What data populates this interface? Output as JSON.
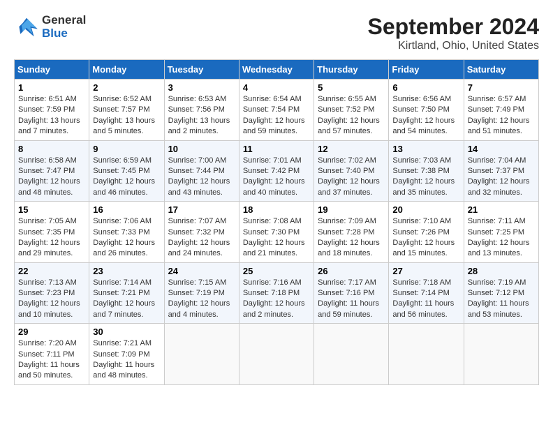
{
  "logo": {
    "line1": "General",
    "line2": "Blue"
  },
  "title": "September 2024",
  "subtitle": "Kirtland, Ohio, United States",
  "days_of_week": [
    "Sunday",
    "Monday",
    "Tuesday",
    "Wednesday",
    "Thursday",
    "Friday",
    "Saturday"
  ],
  "weeks": [
    [
      {
        "day": "1",
        "info": "Sunrise: 6:51 AM\nSunset: 7:59 PM\nDaylight: 13 hours and 7 minutes."
      },
      {
        "day": "2",
        "info": "Sunrise: 6:52 AM\nSunset: 7:57 PM\nDaylight: 13 hours and 5 minutes."
      },
      {
        "day": "3",
        "info": "Sunrise: 6:53 AM\nSunset: 7:56 PM\nDaylight: 13 hours and 2 minutes."
      },
      {
        "day": "4",
        "info": "Sunrise: 6:54 AM\nSunset: 7:54 PM\nDaylight: 12 hours and 59 minutes."
      },
      {
        "day": "5",
        "info": "Sunrise: 6:55 AM\nSunset: 7:52 PM\nDaylight: 12 hours and 57 minutes."
      },
      {
        "day": "6",
        "info": "Sunrise: 6:56 AM\nSunset: 7:50 PM\nDaylight: 12 hours and 54 minutes."
      },
      {
        "day": "7",
        "info": "Sunrise: 6:57 AM\nSunset: 7:49 PM\nDaylight: 12 hours and 51 minutes."
      }
    ],
    [
      {
        "day": "8",
        "info": "Sunrise: 6:58 AM\nSunset: 7:47 PM\nDaylight: 12 hours and 48 minutes."
      },
      {
        "day": "9",
        "info": "Sunrise: 6:59 AM\nSunset: 7:45 PM\nDaylight: 12 hours and 46 minutes."
      },
      {
        "day": "10",
        "info": "Sunrise: 7:00 AM\nSunset: 7:44 PM\nDaylight: 12 hours and 43 minutes."
      },
      {
        "day": "11",
        "info": "Sunrise: 7:01 AM\nSunset: 7:42 PM\nDaylight: 12 hours and 40 minutes."
      },
      {
        "day": "12",
        "info": "Sunrise: 7:02 AM\nSunset: 7:40 PM\nDaylight: 12 hours and 37 minutes."
      },
      {
        "day": "13",
        "info": "Sunrise: 7:03 AM\nSunset: 7:38 PM\nDaylight: 12 hours and 35 minutes."
      },
      {
        "day": "14",
        "info": "Sunrise: 7:04 AM\nSunset: 7:37 PM\nDaylight: 12 hours and 32 minutes."
      }
    ],
    [
      {
        "day": "15",
        "info": "Sunrise: 7:05 AM\nSunset: 7:35 PM\nDaylight: 12 hours and 29 minutes."
      },
      {
        "day": "16",
        "info": "Sunrise: 7:06 AM\nSunset: 7:33 PM\nDaylight: 12 hours and 26 minutes."
      },
      {
        "day": "17",
        "info": "Sunrise: 7:07 AM\nSunset: 7:32 PM\nDaylight: 12 hours and 24 minutes."
      },
      {
        "day": "18",
        "info": "Sunrise: 7:08 AM\nSunset: 7:30 PM\nDaylight: 12 hours and 21 minutes."
      },
      {
        "day": "19",
        "info": "Sunrise: 7:09 AM\nSunset: 7:28 PM\nDaylight: 12 hours and 18 minutes."
      },
      {
        "day": "20",
        "info": "Sunrise: 7:10 AM\nSunset: 7:26 PM\nDaylight: 12 hours and 15 minutes."
      },
      {
        "day": "21",
        "info": "Sunrise: 7:11 AM\nSunset: 7:25 PM\nDaylight: 12 hours and 13 minutes."
      }
    ],
    [
      {
        "day": "22",
        "info": "Sunrise: 7:13 AM\nSunset: 7:23 PM\nDaylight: 12 hours and 10 minutes."
      },
      {
        "day": "23",
        "info": "Sunrise: 7:14 AM\nSunset: 7:21 PM\nDaylight: 12 hours and 7 minutes."
      },
      {
        "day": "24",
        "info": "Sunrise: 7:15 AM\nSunset: 7:19 PM\nDaylight: 12 hours and 4 minutes."
      },
      {
        "day": "25",
        "info": "Sunrise: 7:16 AM\nSunset: 7:18 PM\nDaylight: 12 hours and 2 minutes."
      },
      {
        "day": "26",
        "info": "Sunrise: 7:17 AM\nSunset: 7:16 PM\nDaylight: 11 hours and 59 minutes."
      },
      {
        "day": "27",
        "info": "Sunrise: 7:18 AM\nSunset: 7:14 PM\nDaylight: 11 hours and 56 minutes."
      },
      {
        "day": "28",
        "info": "Sunrise: 7:19 AM\nSunset: 7:12 PM\nDaylight: 11 hours and 53 minutes."
      }
    ],
    [
      {
        "day": "29",
        "info": "Sunrise: 7:20 AM\nSunset: 7:11 PM\nDaylight: 11 hours and 50 minutes."
      },
      {
        "day": "30",
        "info": "Sunrise: 7:21 AM\nSunset: 7:09 PM\nDaylight: 11 hours and 48 minutes."
      },
      {
        "day": "",
        "info": ""
      },
      {
        "day": "",
        "info": ""
      },
      {
        "day": "",
        "info": ""
      },
      {
        "day": "",
        "info": ""
      },
      {
        "day": "",
        "info": ""
      }
    ]
  ]
}
